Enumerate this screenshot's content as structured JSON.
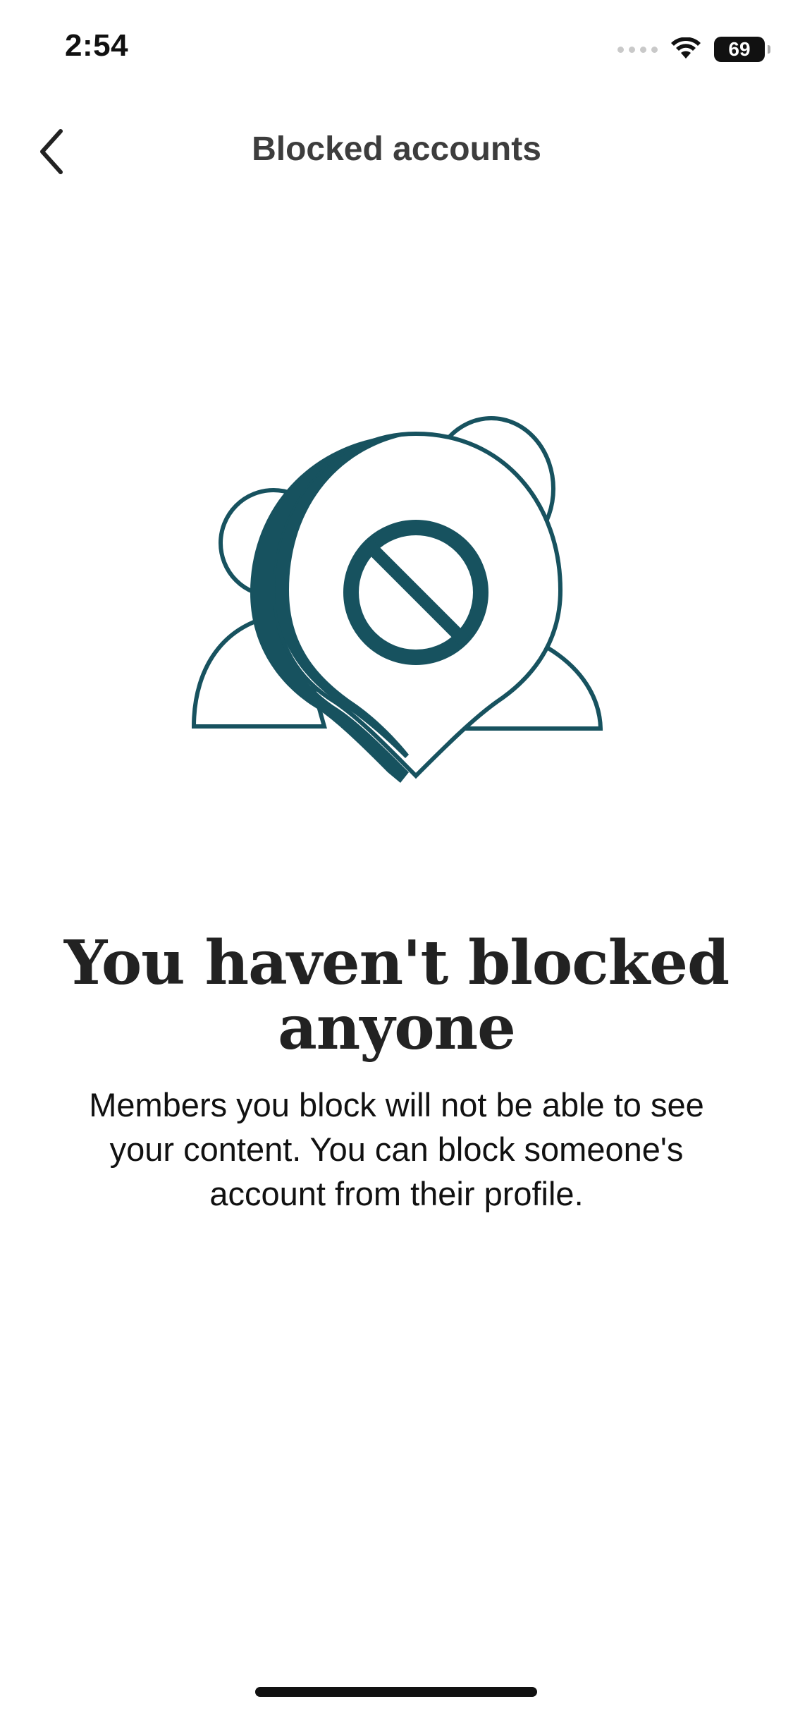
{
  "status_bar": {
    "time": "2:54",
    "battery_level": "69",
    "icons": [
      "signal-dots-icon",
      "wifi-icon",
      "battery-icon"
    ]
  },
  "nav": {
    "title": "Blocked accounts",
    "back_icon": "chevron-left-icon"
  },
  "illustration": {
    "name": "blocked-pin-illustration",
    "accent_color": "#17525f"
  },
  "empty_state": {
    "title": "You haven't blocked anyone",
    "body": "Members you block will not be able to see your content. You can block someone's account from their profile."
  },
  "colors": {
    "background": "#ffffff",
    "accent": "#17525f",
    "text": "#222222"
  }
}
